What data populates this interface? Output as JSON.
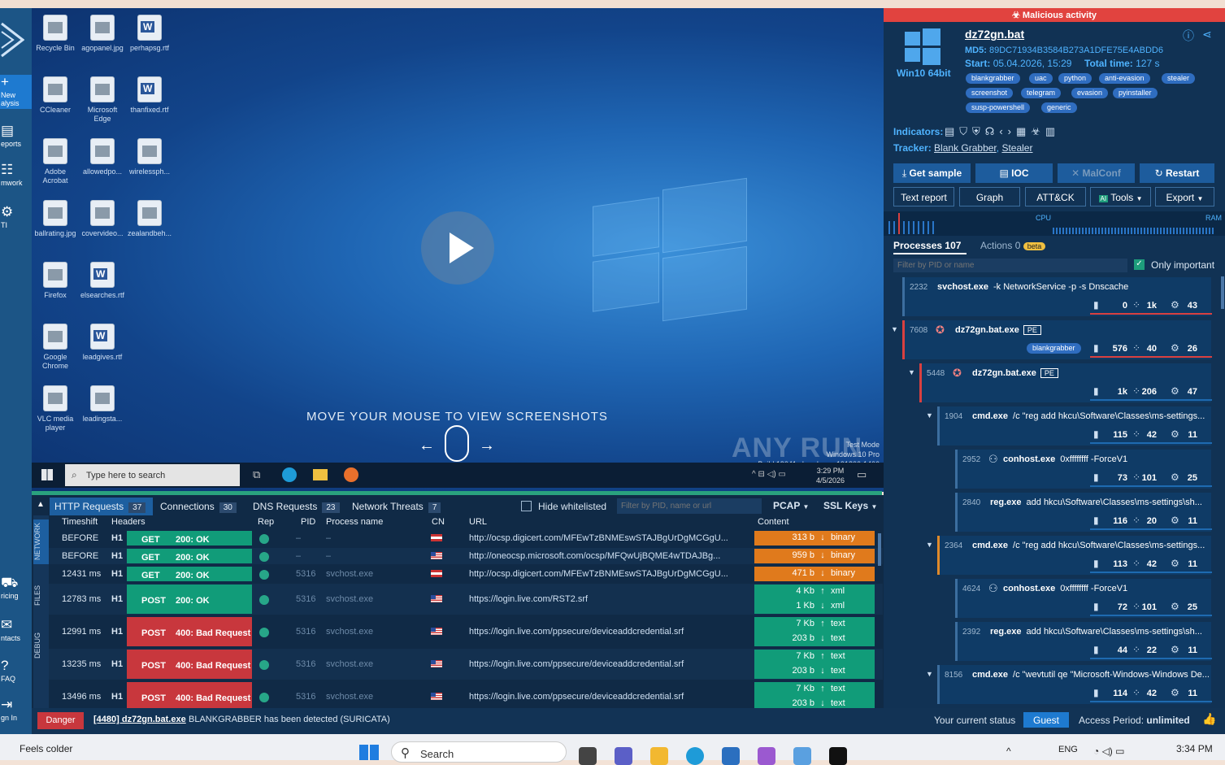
{
  "nav": [
    {
      "label": "New\nalysis"
    },
    {
      "label": "eports"
    },
    {
      "label": "mwork"
    },
    {
      "label": "TI"
    },
    {
      "label": "ricing"
    },
    {
      "label": "ntacts"
    },
    {
      "label": "FAQ"
    },
    {
      "label": "gn In"
    }
  ],
  "desktop_icons": [
    {
      "label": "Recycle Bin",
      "kind": "g"
    },
    {
      "label": "agopanel.jpg",
      "kind": "g"
    },
    {
      "label": "perhapsg.rtf",
      "kind": "w"
    },
    {
      "label": "CCleaner",
      "kind": "g"
    },
    {
      "label": "Microsoft Edge",
      "kind": "g"
    },
    {
      "label": "thanfixed.rtf",
      "kind": "w"
    },
    {
      "label": "Adobe Acrobat",
      "kind": "g"
    },
    {
      "label": "allowedpo...",
      "kind": "g"
    },
    {
      "label": "wirelessph...",
      "kind": "g"
    },
    {
      "label": "ballrating.jpg",
      "kind": "g"
    },
    {
      "label": "covervideo...",
      "kind": "g"
    },
    {
      "label": "zealandbeh...",
      "kind": "g"
    },
    {
      "label": "Firefox",
      "kind": "g"
    },
    {
      "label": "elsearches.rtf",
      "kind": "w"
    },
    {
      "label": "Google Chrome",
      "kind": "g"
    },
    {
      "label": "leadgives.rtf",
      "kind": "w"
    },
    {
      "label": "VLC media player",
      "kind": "g"
    },
    {
      "label": "leadingsta...",
      "kind": "g"
    }
  ],
  "screen": {
    "move_msg": "MOVE YOUR MOUSE TO VIEW SCREENSHOTS",
    "watermark": "ANY RUN",
    "test_mode": "Test Mode",
    "win_ver": "Windows 10 Pro",
    "build": "Build 19041.vb_release.191206-1406",
    "search_placeholder": "Type here to search",
    "clock_time": "3:29 PM",
    "clock_date": "4/5/2026"
  },
  "net": {
    "tabs": [
      {
        "label": "HTTP Requests",
        "count": "37"
      },
      {
        "label": "Connections",
        "count": "30"
      },
      {
        "label": "DNS Requests",
        "count": "23"
      },
      {
        "label": "Network Threats",
        "count": "7"
      }
    ],
    "hide_whitelisted": "Hide whitelisted",
    "filter_placeholder": "Filter by PID, name or url",
    "pcap": "PCAP",
    "ssl": "SSL Keys",
    "side_tabs": [
      "NETWORK",
      "FILES",
      "DEBUG"
    ],
    "headers": {
      "timeshift": "Timeshift",
      "headers": "Headers",
      "rep": "Rep",
      "pid": "PID",
      "pname": "Process name",
      "cn": "CN",
      "url": "URL",
      "content": "Content"
    },
    "rows": [
      {
        "time": "BEFORE",
        "h": "H1",
        "method": "GET",
        "status": "200: OK",
        "ok": true,
        "pid": "–",
        "pname": "–",
        "flag": "nl",
        "url": "http://ocsp.digicert.com/MFEwTzBNMEswSTAJBgUrDgMCGgU...",
        "c1": "313 b",
        "t1": "binary",
        "orange": true
      },
      {
        "time": "BEFORE",
        "h": "H1",
        "method": "GET",
        "status": "200: OK",
        "ok": true,
        "pid": "–",
        "pname": "–",
        "flag": "us",
        "url": "http://oneocsp.microsoft.com/ocsp/MFQwUjBQME4wTDAJBg...",
        "c1": "959 b",
        "t1": "binary",
        "orange": true
      },
      {
        "time": "12431 ms",
        "h": "H1",
        "method": "GET",
        "status": "200: OK",
        "ok": true,
        "pid": "5316",
        "pname": "svchost.exe",
        "flag": "nl",
        "url": "http://ocsp.digicert.com/MFEwTzBNMEswSTAJBgUrDgMCGgU...",
        "c1": "471 b",
        "t1": "binary",
        "orange": true
      },
      {
        "time": "12783 ms",
        "h": "H1",
        "method": "POST",
        "status": "200: OK",
        "ok": true,
        "pid": "5316",
        "pname": "svchost.exe",
        "flag": "us",
        "url": "https://login.live.com/RST2.srf",
        "c1": "4 Kb",
        "t1": "xml",
        "c2": "1 Kb",
        "t2": "xml",
        "orange": false
      },
      {
        "time": "12991 ms",
        "h": "H1",
        "method": "POST",
        "status": "400: Bad Request",
        "ok": false,
        "pid": "5316",
        "pname": "svchost.exe",
        "flag": "us",
        "url": "https://login.live.com/ppsecure/deviceaddcredential.srf",
        "c1": "7 Kb",
        "t1": "text",
        "c2": "203 b",
        "t2": "text",
        "orange": false
      },
      {
        "time": "13235 ms",
        "h": "H1",
        "method": "POST",
        "status": "400: Bad Request",
        "ok": false,
        "pid": "5316",
        "pname": "svchost.exe",
        "flag": "us",
        "url": "https://login.live.com/ppsecure/deviceaddcredential.srf",
        "c1": "7 Kb",
        "t1": "text",
        "c2": "203 b",
        "t2": "text",
        "orange": false
      },
      {
        "time": "13496 ms",
        "h": "H1",
        "method": "POST",
        "status": "400: Bad Request",
        "ok": false,
        "pid": "5316",
        "pname": "svchost.exe",
        "flag": "us",
        "url": "https://login.live.com/ppsecure/deviceaddcredential.srf",
        "c1": "7 Kb",
        "t1": "text",
        "c2": "203 b",
        "t2": "text",
        "orange": false
      }
    ]
  },
  "bottom": {
    "danger": "Danger",
    "process_link": "[4480] dz72gn.bat.exe",
    "message": "BLANKGRABBER has been detected (SURICATA)",
    "status_label": "Your current status",
    "status_value": "Guest",
    "access_label": "Access Period:",
    "access_value": "unlimited"
  },
  "report": {
    "banner": "Malicious activity",
    "filename": "dz72gn.bat",
    "os": "Win10 64bit",
    "md5_label": "MD5:",
    "md5": "89DC71934B3584B273A1DFE75E4ABDD6",
    "start_label": "Start:",
    "start": "05.04.2026, 15:29",
    "total_label": "Total time:",
    "total": "127 s",
    "tags": [
      "blankgrabber",
      "uac",
      "python",
      "anti-evasion",
      "stealer",
      "screenshot",
      "telegram",
      "evasion",
      "pyinstaller",
      "susp-powershell",
      "generic"
    ],
    "indicators_label": "Indicators:",
    "tracker_label": "Tracker:",
    "tracker1": "Blank Grabber",
    "tracker2": "Stealer",
    "buttons1": [
      "Get sample",
      "IOC",
      "MalConf",
      "Restart"
    ],
    "buttons2": [
      "Text report",
      "Graph",
      "ATT&CK",
      "Tools",
      "Export"
    ],
    "cpu": "CPU",
    "ram": "RAM",
    "processes_label": "Processes",
    "processes_count": "107",
    "actions_label": "Actions",
    "actions_count": "0",
    "beta": "beta",
    "filter_placeholder": "Filter by PID or name",
    "only_important": "Only important",
    "procs": [
      {
        "pid": "2232",
        "name": "svchost.exe",
        "args": "-k NetworkService -p -s Dnscache",
        "s1": "0",
        "s2": "1k",
        "s3": "43",
        "pe": false
      },
      {
        "pid": "7608",
        "name": "dz72gn.bat.exe",
        "args": "",
        "s1": "576",
        "s2": "40",
        "s3": "26",
        "pe": true,
        "tag": "blankgrabber"
      },
      {
        "pid": "5448",
        "name": "dz72gn.bat.exe",
        "args": "",
        "s1": "1k",
        "s2": "206",
        "s3": "47",
        "pe": true
      },
      {
        "pid": "1904",
        "name": "cmd.exe",
        "args": "/c \"reg add hkcu\\Software\\Classes\\ms-settings...",
        "s1": "115",
        "s2": "42",
        "s3": "11",
        "pe": false
      },
      {
        "pid": "2952",
        "name": "conhost.exe",
        "args": "0xffffffff -ForceV1",
        "s1": "73",
        "s2": "101",
        "s3": "25",
        "pe": false
      },
      {
        "pid": "2840",
        "name": "reg.exe",
        "args": "add hkcu\\Software\\Classes\\ms-settings\\sh...",
        "s1": "116",
        "s2": "20",
        "s3": "11",
        "pe": false
      },
      {
        "pid": "2364",
        "name": "cmd.exe",
        "args": "/c \"reg add hkcu\\Software\\Classes\\ms-settings...",
        "s1": "113",
        "s2": "42",
        "s3": "11",
        "pe": false
      },
      {
        "pid": "4624",
        "name": "conhost.exe",
        "args": "0xffffffff -ForceV1",
        "s1": "72",
        "s2": "101",
        "s3": "25",
        "pe": false
      },
      {
        "pid": "2392",
        "name": "reg.exe",
        "args": "add hkcu\\Software\\Classes\\ms-settings\\sh...",
        "s1": "44",
        "s2": "22",
        "s3": "11",
        "pe": false
      },
      {
        "pid": "8156",
        "name": "cmd.exe",
        "args": "/c \"wevtutil qe \"Microsoft-Windows-Windows De...",
        "s1": "114",
        "s2": "42",
        "s3": "11",
        "pe": false
      }
    ]
  },
  "winbar": {
    "weather": "Feels colder",
    "search": "Search",
    "lang": "ENG",
    "time": "3:34 PM"
  },
  "colors": {
    "accent": "#1d5fa0",
    "danger": "#c8373d",
    "ok": "#119c79",
    "orange": "#e07a1c"
  }
}
